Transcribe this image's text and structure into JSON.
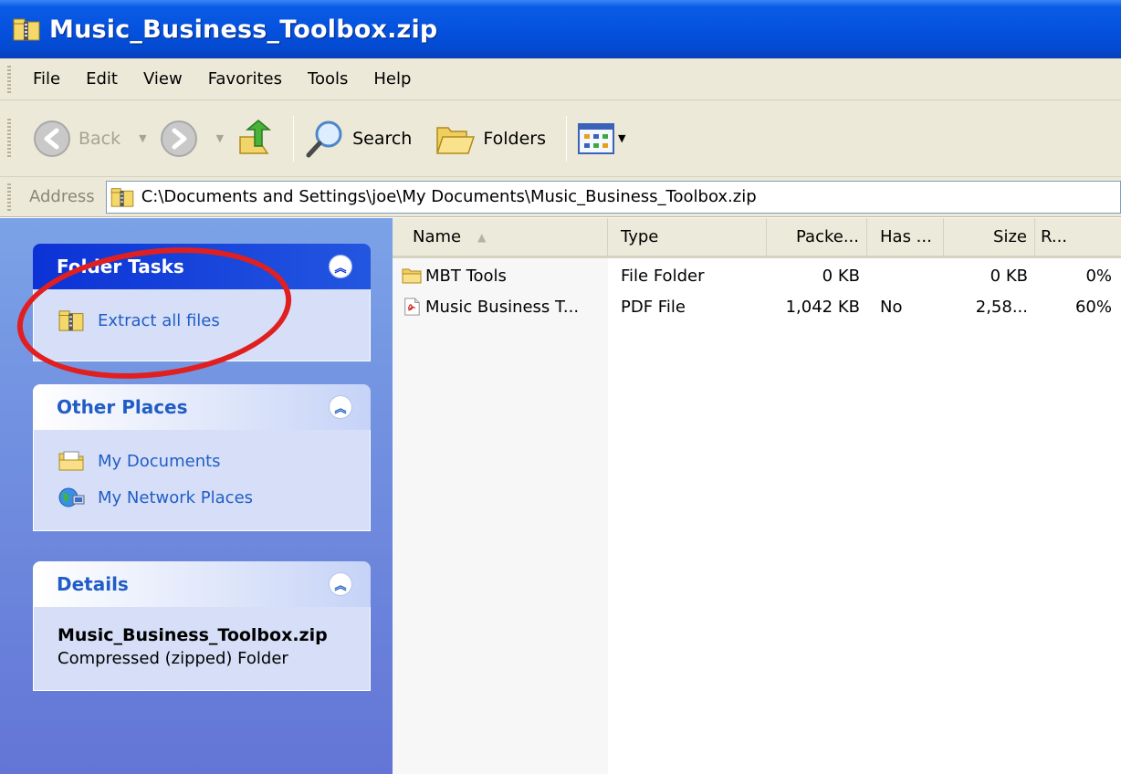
{
  "window": {
    "title": "Music_Business_Toolbox.zip",
    "icon": "zip-folder-icon"
  },
  "menu": [
    "File",
    "Edit",
    "View",
    "Favorites",
    "Tools",
    "Help"
  ],
  "toolbar": {
    "back_label": "Back",
    "search_label": "Search",
    "folders_label": "Folders"
  },
  "address": {
    "label": "Address",
    "path": "C:\\Documents and Settings\\joe\\My Documents\\Music_Business_Toolbox.zip"
  },
  "sidebar": {
    "folder_tasks": {
      "title": "Folder Tasks",
      "items": [
        "Extract all files"
      ]
    },
    "other_places": {
      "title": "Other Places",
      "items": [
        "My Documents",
        "My Network Places"
      ]
    },
    "details": {
      "title": "Details",
      "name": "Music_Business_Toolbox.zip",
      "type": "Compressed (zipped) Folder"
    }
  },
  "file_list": {
    "columns": [
      "Name",
      "Type",
      "Packe...",
      "Has ...",
      "Size",
      "R..."
    ],
    "rows": [
      {
        "name": "MBT Tools",
        "type": "File Folder",
        "packed": "0 KB",
        "has": "",
        "size": "0 KB",
        "ratio": "0%",
        "icon": "folder-icon"
      },
      {
        "name": "Music Business T...",
        "type": "PDF File",
        "packed": "1,042 KB",
        "has": "No",
        "size": "2,58...",
        "ratio": "60%",
        "icon": "pdf-file-icon"
      }
    ]
  },
  "annotation": {
    "color": "#e02020"
  }
}
